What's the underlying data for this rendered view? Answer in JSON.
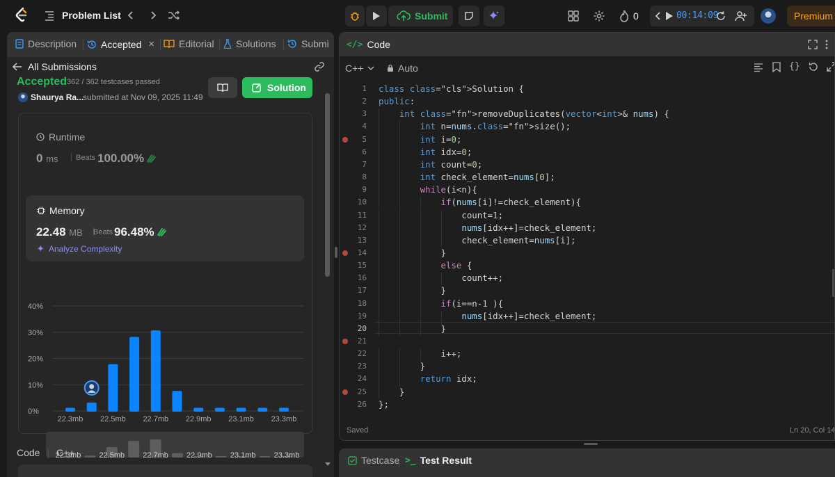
{
  "topbar": {
    "problem_list_label": "Problem List",
    "submit_label": "Submit",
    "streak_count": "0",
    "timer": "00:14:09",
    "premium_label": "Premium"
  },
  "left_tabs": [
    {
      "label": "Description"
    },
    {
      "label": "Accepted"
    },
    {
      "label": "Editorial"
    },
    {
      "label": "Solutions"
    },
    {
      "label": "Submi"
    }
  ],
  "submission": {
    "back_label": "All Submissions",
    "status": "Accepted",
    "testcases": "362 / 362 testcases passed",
    "author": "Shaurya Ra...",
    "submitted_at": "submitted at Nov 09, 2025 11:49",
    "solution_label": "Solution",
    "runtime": {
      "label": "Runtime",
      "value": "0",
      "unit": "ms",
      "beats_label": "Beats",
      "beats_value": "100.00%"
    },
    "memory": {
      "label": "Memory",
      "value": "22.48",
      "unit": "MB",
      "beats_label": "Beats",
      "beats_value": "96.48%"
    },
    "analyze_label": "Analyze Complexity",
    "code_label": "Code",
    "code_lang": "C++"
  },
  "chart_data": {
    "type": "bar",
    "title": "",
    "xlabel": "",
    "ylabel": "",
    "ylim": [
      0,
      40
    ],
    "y_ticks": [
      "40%",
      "30%",
      "20%",
      "10%",
      "0%"
    ],
    "x_tick_labels": [
      "22.3mb",
      "22.5mb",
      "22.7mb",
      "22.9mb",
      "23.1mb",
      "23.3mb"
    ],
    "x": [
      22.3,
      22.4,
      22.5,
      22.6,
      22.7,
      22.8,
      22.9,
      23.0,
      23.1,
      23.2,
      23.3
    ],
    "values": [
      1.2,
      3.2,
      17.8,
      28.2,
      30.7,
      7.6,
      1.2,
      1.2,
      1.2,
      1.2,
      1.2
    ],
    "highlight_index": 1,
    "highlight_color": "#0a84ff"
  },
  "editor": {
    "title": "Code",
    "language": "C++",
    "mode": "Auto",
    "saved_label": "Saved",
    "cursor_position": "Ln 20, Col 14",
    "breakpoint_lines": [
      5,
      14,
      21,
      25
    ],
    "current_line": 20,
    "lines": [
      "class Solution {",
      "public:",
      "    int removeDuplicates(vector<int>& nums) {",
      "        int n=nums.size();",
      "        int i=0;",
      "        int idx=0;",
      "        int count=0;",
      "        int check_element=nums[0];",
      "        while(i<n){",
      "            if(nums[i]!=check_element){",
      "                count=1;",
      "                nums[idx++]=check_element;",
      "                check_element=nums[i];",
      "            }",
      "            else {",
      "                count++;",
      "            }",
      "            if(i==n-1 ){",
      "                nums[idx++]=check_element;",
      "            }",
      "",
      "            i++;",
      "        }",
      "        return idx;",
      "    }",
      "};"
    ]
  },
  "bottom_tabs": [
    {
      "label": "Testcase"
    },
    {
      "label": "Test Result"
    }
  ]
}
